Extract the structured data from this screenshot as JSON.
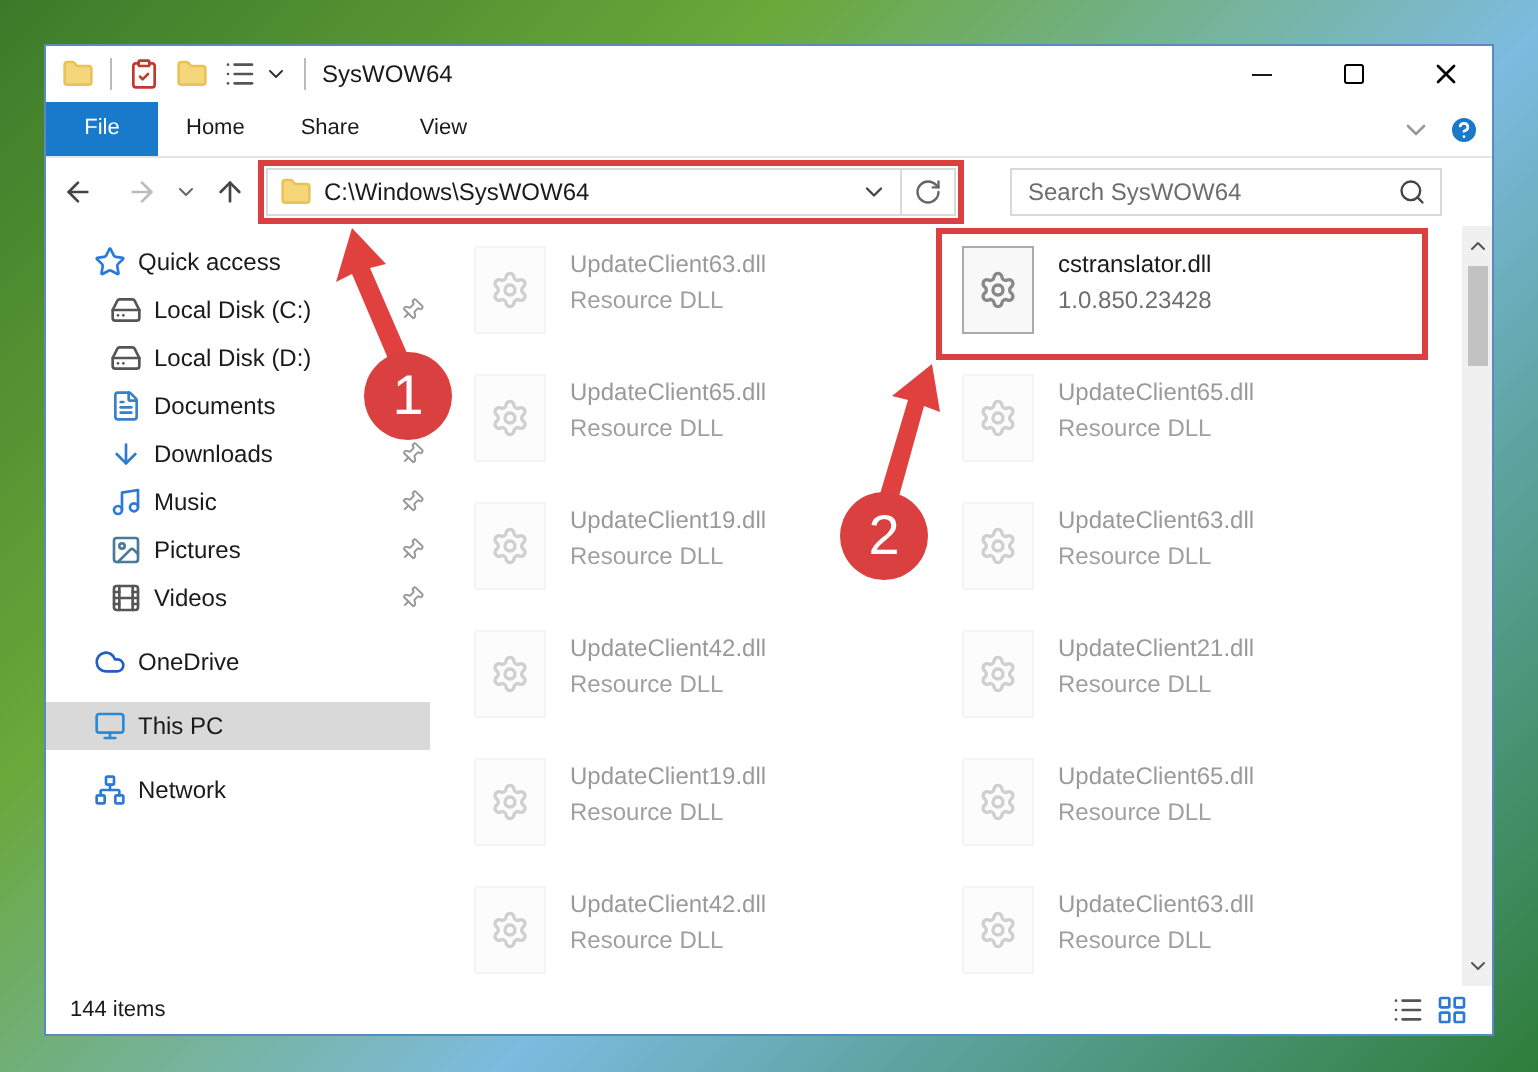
{
  "window": {
    "title": "SysWOW64"
  },
  "ribbon_tabs": [
    {
      "label": "File",
      "selected": true
    },
    {
      "label": "Home",
      "selected": false
    },
    {
      "label": "Share",
      "selected": false
    },
    {
      "label": "View",
      "selected": false
    }
  ],
  "address": {
    "path": "C:\\Windows\\SysWOW64"
  },
  "search": {
    "placeholder": "Search SysWOW64"
  },
  "sidebar": {
    "items": [
      {
        "label": "Quick access",
        "kind": "star",
        "selected": false,
        "children": [
          {
            "label": "Local Disk (C:)",
            "kind": "drive",
            "pinned": true,
            "selected": false
          },
          {
            "label": "Local Disk (D:)",
            "kind": "drive",
            "selected": false
          },
          {
            "label": "Documents",
            "kind": "documents",
            "selected": false
          },
          {
            "label": "Downloads",
            "kind": "downloads",
            "pinned": true,
            "selected": false
          },
          {
            "label": "Music",
            "kind": "music",
            "pinned": true,
            "selected": false
          },
          {
            "label": "Pictures",
            "kind": "pictures",
            "pinned": true,
            "selected": false
          },
          {
            "label": "Videos",
            "kind": "videos",
            "pinned": true,
            "selected": false
          }
        ]
      },
      {
        "label": "OneDrive",
        "kind": "cloud",
        "selected": false
      },
      {
        "label": "This PC",
        "kind": "pc",
        "selected": true
      },
      {
        "label": "Network",
        "kind": "network",
        "selected": false
      }
    ]
  },
  "files": [
    {
      "name": "UpdateClient63.dll",
      "detail": "Resource DLL",
      "faded": true
    },
    {
      "name": "cstranslator.dll",
      "detail": "1.0.850.23428",
      "faded": false
    },
    {
      "name": "UpdateClient65.dll",
      "detail": "Resource DLL",
      "faded": true
    },
    {
      "name": "UpdateClient65.dll",
      "detail": "Resource DLL",
      "faded": true
    },
    {
      "name": "UpdateClient19.dll",
      "detail": "Resource DLL",
      "faded": true
    },
    {
      "name": "UpdateClient63.dll",
      "detail": "Resource DLL",
      "faded": true
    },
    {
      "name": "UpdateClient42.dll",
      "detail": "Resource DLL",
      "faded": true
    },
    {
      "name": "UpdateClient21.dll",
      "detail": "Resource DLL",
      "faded": true
    },
    {
      "name": "UpdateClient19.dll",
      "detail": "Resource DLL",
      "faded": true
    },
    {
      "name": "UpdateClient65.dll",
      "detail": "Resource DLL",
      "faded": true
    },
    {
      "name": "UpdateClient42.dll",
      "detail": "Resource DLL",
      "faded": true
    },
    {
      "name": "UpdateClient63.dll",
      "detail": "Resource DLL",
      "faded": true
    }
  ],
  "status_bar": {
    "count": "144 items"
  },
  "annotations": [
    {
      "label": "1"
    },
    {
      "label": "2"
    }
  ]
}
